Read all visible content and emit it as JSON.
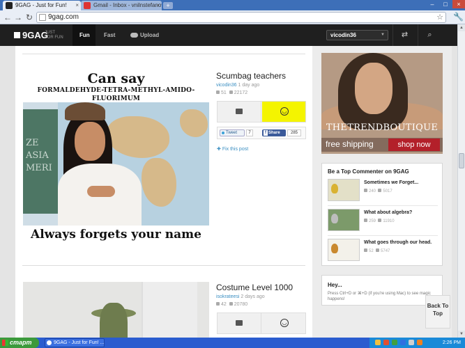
{
  "browser": {
    "tabs": [
      {
        "title": "9GAG - Just for Fun!",
        "active": true
      },
      {
        "title": "Gmail - Inbox - vnilnstefanovar",
        "active": false
      }
    ],
    "new_tab_label": "+",
    "address": "9gag.com",
    "close_label": "×",
    "back_icon": "arrow-left-icon",
    "forward_icon": "arrow-right-icon",
    "reload_icon": "reload-icon"
  },
  "site": {
    "logo": "9GAG",
    "tagline_1": "JUST",
    "tagline_2": "FOR FUN",
    "nav": {
      "fun": "Fun",
      "fast": "Fast",
      "upload": "Upload"
    },
    "user": "vicodin36"
  },
  "post1": {
    "meme_top_1": "Can say",
    "meme_top_2": "FORMALDEHYDE-TETRA-METHYL-AMIDO-FLUORIMUM",
    "meme_bottom": "Always forgets your name",
    "board_text": "ZE\nASIA\nMERI",
    "title": "Scumbag teachers",
    "author": "vicodin36",
    "time": "1 day ago",
    "comments": "51",
    "likes": "22172",
    "tweet_label": "Tweet",
    "tweet_count": "7",
    "share_label": "Share",
    "share_count": "285",
    "fix_label": "Fix this post"
  },
  "post2": {
    "title": "Costume Level 1000",
    "author": "isokrateesi",
    "time": "2 days ago",
    "comments": "42",
    "likes": "20780"
  },
  "ad": {
    "brand": "THETRENDBOUTIQUE",
    "free_shipping": "free shipping",
    "shop_now": "shop now"
  },
  "top_commenter": {
    "title": "Be a Top Commenter on 9GAG",
    "items": [
      {
        "title": "Sometimes we Forget...",
        "comments": "240",
        "likes": "5017"
      },
      {
        "title": "What about algebra?",
        "comments": "259",
        "likes": "11910"
      },
      {
        "title": "What goes through our head.",
        "comments": "52",
        "likes": "5747"
      }
    ]
  },
  "hey": {
    "title": "Hey...",
    "text": "Press Ctrl+D or ⌘+D (if you're using Mac) to see magic happens!"
  },
  "back_to_top": "Back To Top",
  "taskbar": {
    "start": "старт",
    "task": "9GAG - Just for Fun! ...",
    "clock": "2:26 PM"
  }
}
